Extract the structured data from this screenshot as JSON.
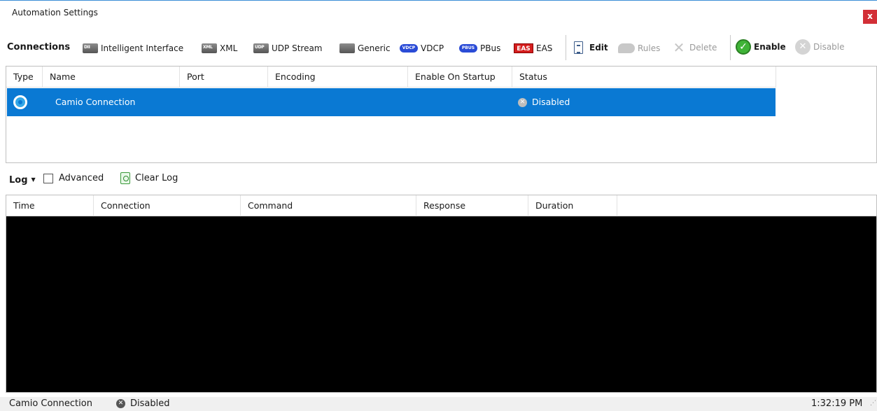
{
  "window": {
    "title": "Automation Settings",
    "close_label": "x"
  },
  "toolbar": {
    "heading": "Connections",
    "items": [
      {
        "label": "Intelligent Interface",
        "icon": "monitor-icon",
        "badge": "DII"
      },
      {
        "label": "XML",
        "icon": "monitor-icon",
        "badge": "XML"
      },
      {
        "label": "UDP Stream",
        "icon": "monitor-icon",
        "badge": "UDP"
      },
      {
        "label": "Generic",
        "icon": "monitor-icon",
        "badge": ""
      },
      {
        "label": "VDCP",
        "icon": "pill-icon",
        "badge": "VDCP"
      },
      {
        "label": "PBus",
        "icon": "pill-icon",
        "badge": "PBUS"
      },
      {
        "label": "EAS",
        "icon": "eas-icon",
        "badge": "EAS"
      }
    ],
    "edit_label": "Edit",
    "rules_label": "Rules",
    "delete_label": "Delete",
    "enable_label": "Enable",
    "disable_label": "Disable"
  },
  "connections_table": {
    "columns": [
      "Type",
      "Name",
      "Port",
      "Encoding",
      "Enable On Startup",
      "Status"
    ],
    "rows": [
      {
        "type_icon": "camio-icon",
        "name": "Camio Connection",
        "port": "",
        "encoding": "",
        "enable_on_startup": "",
        "status": "Disabled"
      }
    ]
  },
  "log": {
    "label": "Log",
    "advanced_label": "Advanced",
    "advanced_checked": false,
    "clear_label": "Clear Log",
    "columns": [
      "Time",
      "Connection",
      "Command",
      "Response",
      "Duration"
    ]
  },
  "status_bar": {
    "connection": "Camio Connection",
    "status": "Disabled",
    "time": "1:32:19 PM"
  },
  "colors": {
    "selection": "#0a79d3",
    "close_button": "#d22f36",
    "log_background": "#000000"
  }
}
